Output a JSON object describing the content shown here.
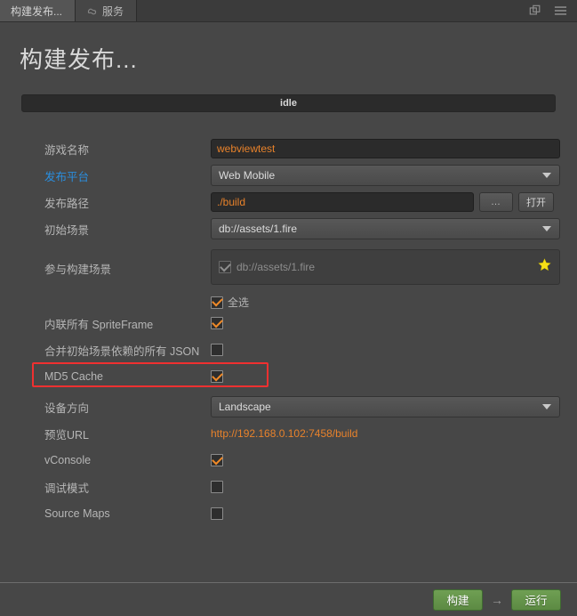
{
  "window": {
    "tabs": [
      {
        "label": "构建发布...",
        "active": true,
        "icon": null
      },
      {
        "label": "服务",
        "active": false,
        "icon": "services-icon"
      }
    ],
    "tools": [
      {
        "name": "popout-window-icon"
      },
      {
        "name": "hamburger-menu-icon"
      }
    ]
  },
  "header": {
    "title": "构建发布...",
    "status": "idle"
  },
  "form": {
    "game_name": {
      "label": "游戏名称",
      "value": "webviewtest"
    },
    "platform": {
      "label": "发布平台",
      "value": "Web Mobile"
    },
    "build_path": {
      "label": "发布路径",
      "value": "./build",
      "browse_label": "…",
      "open_label": "打开"
    },
    "start_scene": {
      "label": "初始场景",
      "value": "db://assets/1.fire"
    },
    "included_scenes": {
      "label": "参与构建场景",
      "items": [
        {
          "text": "db://assets/1.fire",
          "checked": true
        }
      ],
      "select_all_label": "全选",
      "select_all_checked": true,
      "star_icon": "star-icon"
    },
    "inline_spriteframe": {
      "label": "内联所有 SpriteFrame",
      "checked": true
    },
    "merge_json": {
      "label": "合并初始场景依赖的所有 JSON",
      "checked": false
    },
    "md5_cache": {
      "label": "MD5 Cache",
      "checked": true,
      "highlighted": true
    },
    "orientation": {
      "label": "设备方向",
      "value": "Landscape"
    },
    "preview_url": {
      "label": "预览URL",
      "value": "http://192.168.0.102:7458/build"
    },
    "vconsole": {
      "label": "vConsole",
      "checked": true
    },
    "debug_mode": {
      "label": "调试模式",
      "checked": false
    },
    "source_maps": {
      "label": "Source Maps",
      "checked": false
    }
  },
  "footer": {
    "build_label": "构建",
    "arrow": "→",
    "run_label": "运行"
  },
  "colors": {
    "background": "#474747",
    "accent_orange": "#e8822b",
    "accent_blue": "#2a8fe0",
    "highlight_red": "#f03030",
    "button_green": "#5c8a43",
    "star_yellow": "#f7e017"
  }
}
